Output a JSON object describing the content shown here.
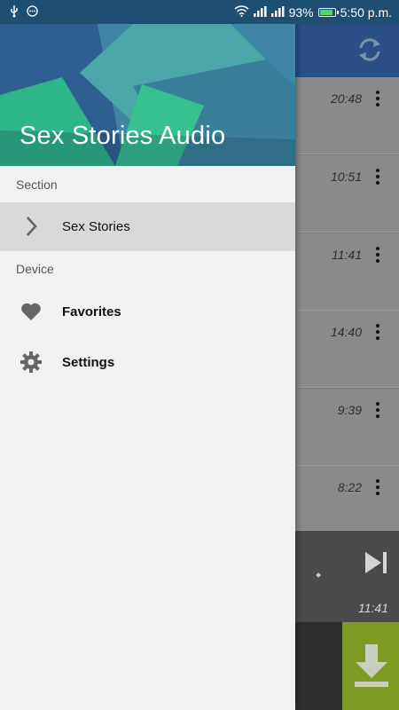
{
  "status_bar": {
    "battery_percent": "93%",
    "time": "5:50 p.m.",
    "icons": [
      "usb-icon",
      "notification-icon",
      "wifi-icon",
      "signal-icon",
      "signal-icon",
      "battery-icon"
    ]
  },
  "drawer": {
    "title": "Sex Stories Audio",
    "section_header": "Section",
    "section_items": [
      {
        "label": "Sex Stories",
        "icon": "chevron-right-icon",
        "active": true
      }
    ],
    "device_header": "Device",
    "device_items": [
      {
        "label": "Favorites",
        "icon": "heart-icon"
      },
      {
        "label": "Settings",
        "icon": "gear-icon"
      }
    ]
  },
  "background_list": {
    "durations": [
      "20:48",
      "10:51",
      "11:41",
      "14:40",
      "9:39",
      "8:22"
    ]
  },
  "player": {
    "time": "11:41"
  },
  "colors": {
    "status_bar": "#1d4f73",
    "toolbar": "#2a4f88",
    "drawer_bg": "#f1f1f1",
    "active_item": "#d9d9d9",
    "download_button": "#7d9a22"
  }
}
